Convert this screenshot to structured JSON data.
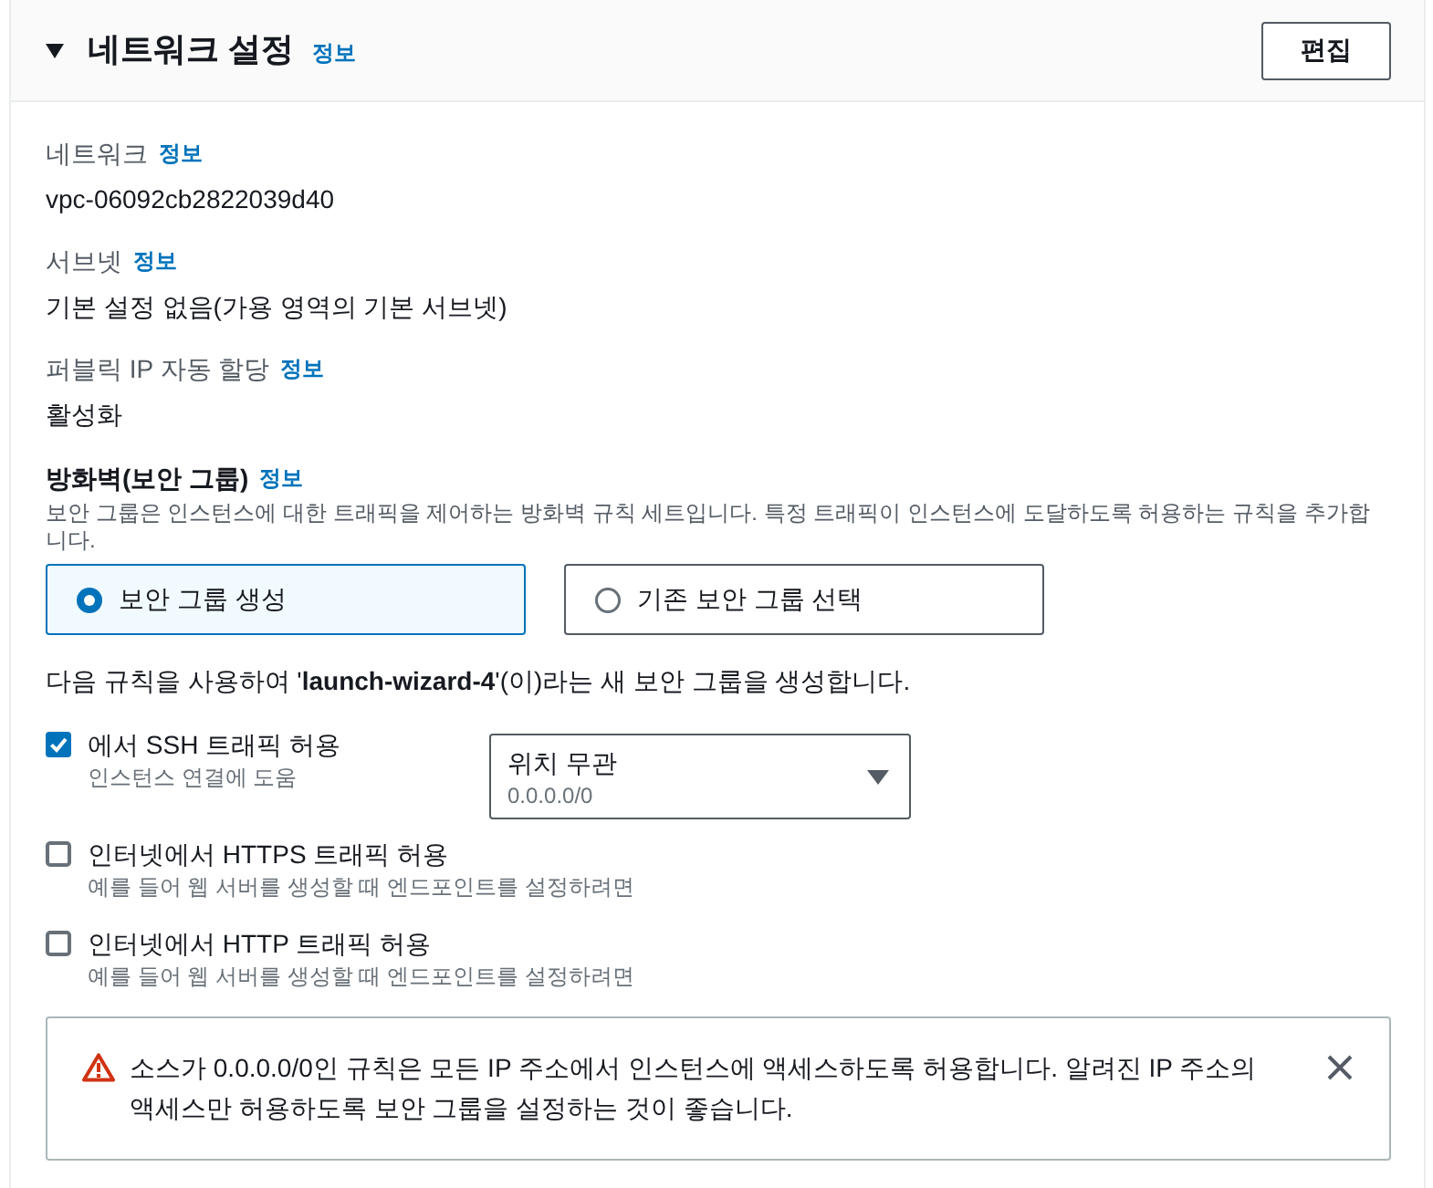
{
  "section": {
    "title": "네트워크 설정",
    "info": "정보",
    "expanded": true,
    "edit_button": "편집"
  },
  "fields": [
    {
      "label": "네트워크",
      "info": "정보",
      "value": "vpc-06092cb2822039d40"
    },
    {
      "label": "서브넷",
      "info": "정보",
      "value": "기본 설정 없음(가용 영역의 기본 서브넷)"
    },
    {
      "label": "퍼블릭 IP 자동 할당",
      "info": "정보",
      "value": "활성화"
    }
  ],
  "firewall": {
    "label": "방화벽(보안 그룹)",
    "info": "정보",
    "description": "보안 그룹은 인스턴스에 대한 트래픽을 제어하는 방화벽 규칙 세트입니다. 특정 트래픽이 인스턴스에 도달하도록 허용하는 규칙을 추가합니다.",
    "options": [
      {
        "label": "보안 그룹 생성",
        "selected": true
      },
      {
        "label": "기존 보안 그룹 선택",
        "selected": false
      }
    ],
    "rule_note": "다음 규칙을 사용하여 '**launch-wizard-4**'(이)라는 새 보안 그룹을 생성합니다."
  },
  "rules": [
    {
      "label": "에서 SSH 트래픽 허용",
      "description": "인스턴스 연결에 도움",
      "checked": true,
      "source": {
        "value": "위치 무관",
        "detail": "0.0.0.0/0"
      }
    },
    {
      "label": "인터넷에서 HTTPS 트래픽 허용",
      "description": "예를 들어 웹 서버를 생성할 때 엔드포인트를 설정하려면",
      "checked": false
    },
    {
      "label": "인터넷에서 HTTP 트래픽 허용",
      "description": "예를 들어 웹 서버를 생성할 때 엔드포인트를 설정하려면",
      "checked": false
    }
  ],
  "alert": {
    "kind": "warning",
    "message": "소스가 0.0.0.0/0인 규칙은 모든 IP 주소에서 인스턴스에 액세스하도록 허용합니다. 알려진 IP 주소의 액세스만 허용하도록 보안 그룹을 설정하는 것이 좋습니다."
  }
}
